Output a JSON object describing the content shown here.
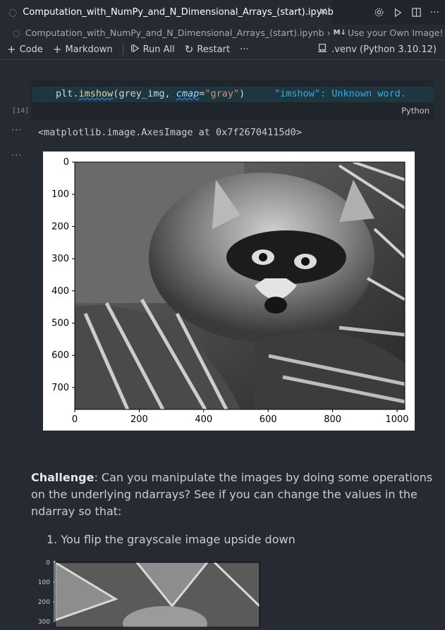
{
  "tab": {
    "title": "Computation_with_NumPy_and_N_Dimensional_Arrays_(start).ipynb",
    "close": "✕"
  },
  "breadcrumb": {
    "file": "Computation_with_NumPy_and_N_Dimensional_Arrays_(start).ipynb",
    "section_icon": "M↓",
    "section": "Use your Own Image!"
  },
  "toolbar": {
    "code": "Code",
    "markdown": "Markdown",
    "run_all": "Run All",
    "restart": "Restart",
    "more": "···",
    "kernel": ".venv (Python 3.10.12)"
  },
  "cell": {
    "exec_count": "[14]",
    "code": {
      "a": "plt.",
      "b": "imshow",
      "c": "(grey_img, ",
      "d": "cmap",
      "e": "=",
      "f": "\"gray\"",
      "g": ")"
    },
    "diagnostic": "\"imshow\": Unknown word.",
    "language": "Python",
    "output_text": "<matplotlib.image.AxesImage at 0x7f26704115d0>"
  },
  "plot": {
    "x_ticks": [
      "0",
      "200",
      "400",
      "600",
      "800",
      "1000"
    ],
    "y_ticks": [
      "0",
      "100",
      "200",
      "300",
      "400",
      "500",
      "600",
      "700"
    ]
  },
  "markdown": {
    "challenge_bold": "Challenge",
    "challenge_text": ": Can you manipulate the images by doing some operations on the underlying ndarrays? See if you can change the values in the ndarray so that:",
    "list_item": "1. You flip the grayscale image upside down"
  },
  "mini_plot": {
    "y_ticks": [
      "0",
      "100",
      "200",
      "300"
    ]
  },
  "colors": {
    "accent": "#e37933",
    "editor_bg": "#262a33",
    "diagnostic": "#3aa9e0"
  }
}
